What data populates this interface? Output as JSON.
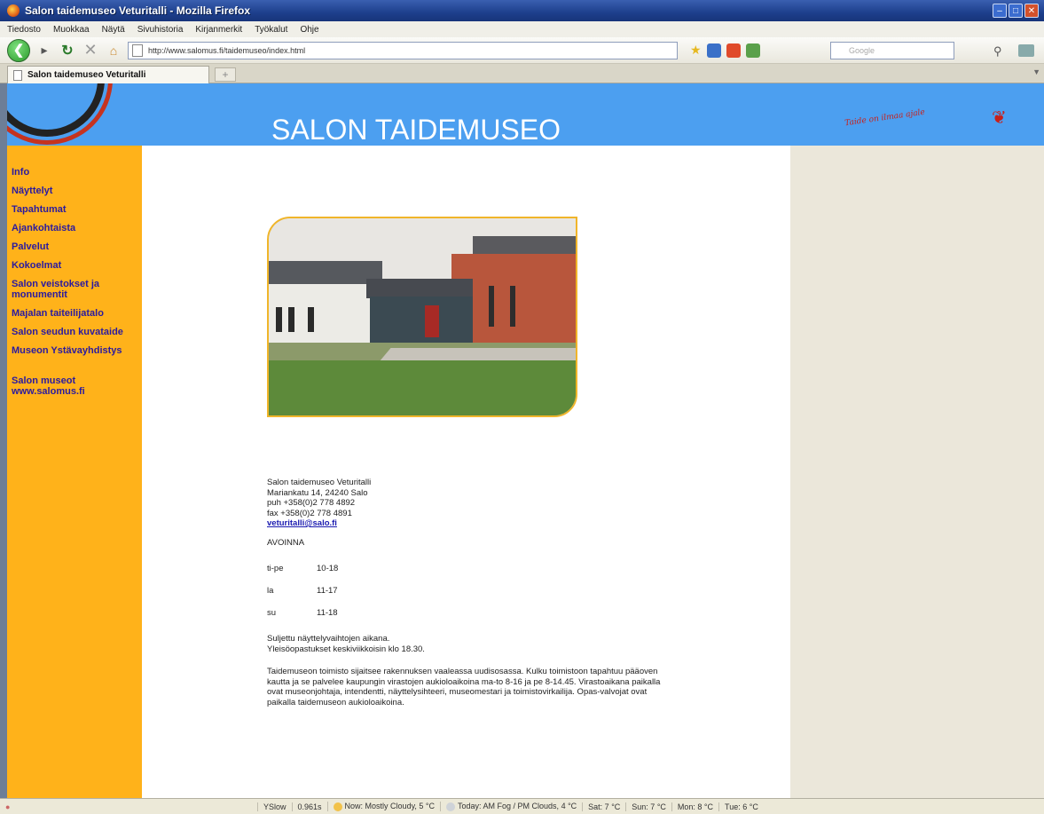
{
  "window": {
    "title": "Salon taidemuseo Veturitalli - Mozilla Firefox",
    "controls": [
      "minimize",
      "maximize",
      "close"
    ]
  },
  "menu": [
    "Tiedosto",
    "Muokkaa",
    "Näytä",
    "Sivuhistoria",
    "Kirjanmerkit",
    "Työkalut",
    "Ohje"
  ],
  "navbar": {
    "url": "http://www.salomus.fi/taidemuseo/index.html",
    "search_placeholder": "Google"
  },
  "tabs": [
    {
      "label": "Salon taidemuseo Veturitalli"
    }
  ],
  "site": {
    "title": "SALON TAIDEMUSEO",
    "slogan": "Taide on ilmaa ajale"
  },
  "sidebar": {
    "items": [
      {
        "label": "Info"
      },
      {
        "label": "Näyttelyt"
      },
      {
        "label": "Tapahtumat"
      },
      {
        "label": "Ajankohtaista"
      },
      {
        "label": "Palvelut"
      },
      {
        "label": "Kokoelmat"
      },
      {
        "label": "Salon veistokset ja monumentit"
      },
      {
        "label": "Majalan taiteilijatalo"
      },
      {
        "label": "Salon seudun kuvataide"
      },
      {
        "label": "Museon Ystävayhdistys"
      },
      {
        "label": "Salon museot www.salomus.fi"
      }
    ]
  },
  "contact": {
    "name": "Salon taidemuseo Veturitalli",
    "address": "Mariankatu 14, 24240 Salo",
    "phone": "puh +358(0)2 778 4892",
    "fax": "fax +358(0)2 778 4891",
    "email": "veturitalli@salo.fi"
  },
  "hours": {
    "heading": "AVOINNA",
    "rows": [
      {
        "day": "ti-pe",
        "time": "10-18"
      },
      {
        "day": "la",
        "time": "11-17"
      },
      {
        "day": "su",
        "time": "11-18"
      }
    ],
    "note_line1": "Suljettu näyttelyvaihtojen aikana.",
    "note_line2": "Yleisöopastukset keskiviikkoisin klo 18.30."
  },
  "office_text": "Taidemuseon toimisto sijaitsee rakennuksen vaaleassa uudisosassa. Kulku toimistoon tapahtuu pääoven kautta ja se palvelee kaupungin virastojen aukioloaikoina ma-to 8-16 ja pe 8-14.45. Virastoaikana paikalla ovat museonjohtaja, intendentti, näyttelysihteeri, museomestari ja toimistovirkailija. Opas-valvojat ovat paikalla taidemuseon aukioloaikoina.",
  "statusbar": {
    "yslow": "YSlow",
    "timing": "0.961s",
    "weather": [
      "Now: Mostly Cloudy, 5 °C",
      "Today: AM Fog / PM Clouds, 4 °C",
      "Sat: 7 °C",
      "Sun: 7 °C",
      "Mon: 8 °C",
      "Tue: 6 °C"
    ]
  }
}
